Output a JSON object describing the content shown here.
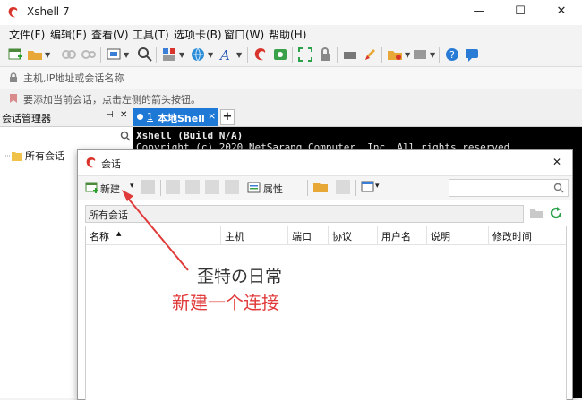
{
  "window": {
    "title": "Xshell 7",
    "buttons": [
      "—",
      "☐",
      "✕"
    ]
  },
  "menu": [
    "文件(F)",
    "编辑(E)",
    "查看(V)",
    "工具(T)",
    "选项卡(B)",
    "窗口(W)",
    "帮助(H)"
  ],
  "address_bar": {
    "placeholder": "主机,IP地址或会话名称"
  },
  "hint_bar": {
    "text": "要添加当前会话，点击左侧的箭头按钮。"
  },
  "session_manager": {
    "title": "会话管理器",
    "pin": "⊣",
    "close": "✕",
    "tree": [
      {
        "label": "所有会话"
      }
    ]
  },
  "tabs": [
    {
      "index": "1",
      "label": "本地Shell",
      "close": "×"
    }
  ],
  "tab_add": "+",
  "terminal": {
    "lines": [
      "Xshell  (Build N/A)",
      "Copyright (c) 2020 NetSarang Computer, Inc. All rights reserved."
    ]
  },
  "dialog": {
    "title": "会话",
    "close": "✕",
    "toolbar": {
      "new_label": "新建",
      "properties_label": "属性",
      "dropdown": "▾"
    },
    "path": "所有会话",
    "columns": [
      "名称",
      "主机",
      "端口",
      "协议",
      "用户名",
      "说明",
      "修改时间"
    ],
    "sort_indicator": "▲"
  },
  "annotation": {
    "watermark": "歪特の日常",
    "caption": "新建一个连接",
    "arrow_color": "#e03a3a"
  },
  "colors": {
    "accent": "#1e78d6",
    "terminal_bg": "#000000",
    "caption": "#e03a3a"
  }
}
